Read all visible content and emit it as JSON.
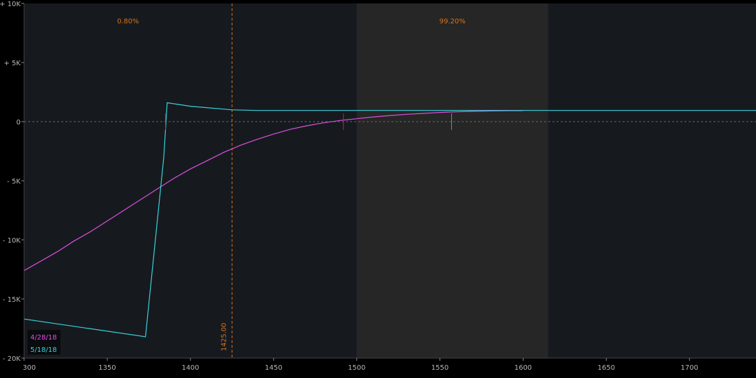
{
  "chart_data": {
    "type": "line",
    "title": "",
    "xlabel": "",
    "ylabel": "",
    "xlim": [
      1300,
      1740
    ],
    "ylim": [
      -20000,
      10000
    ],
    "x_ticks": [
      {
        "value": 1300,
        "label": "300"
      },
      {
        "value": 1350,
        "label": "1350"
      },
      {
        "value": 1400,
        "label": "1400"
      },
      {
        "value": 1450,
        "label": "1450"
      },
      {
        "value": 1500,
        "label": "1500"
      },
      {
        "value": 1550,
        "label": "1550"
      },
      {
        "value": 1600,
        "label": "1600"
      },
      {
        "value": 1650,
        "label": "1650"
      },
      {
        "value": 1700,
        "label": "1700"
      }
    ],
    "y_ticks": [
      {
        "value": 10000,
        "label": "+ 10K"
      },
      {
        "value": 5000,
        "label": "+ 5K"
      },
      {
        "value": 0,
        "label": "0"
      },
      {
        "value": -5000,
        "label": "- 5K"
      },
      {
        "value": -10000,
        "label": "- 10K"
      },
      {
        "value": -15000,
        "label": "- 15K"
      },
      {
        "value": -20000,
        "label": "- 20K"
      }
    ],
    "grid": false,
    "legend_position": "bottom-left",
    "regions": [
      {
        "x_start": 1300,
        "x_end": 1425,
        "label": "0.80%",
        "color": "#161a1f"
      },
      {
        "x_start": 1500,
        "x_end": 1615,
        "label": "99.20%",
        "color": "#262626"
      }
    ],
    "vertical_marker": {
      "x": 1425,
      "label": "1425.00",
      "color": "#d8731a"
    },
    "zero_line_color": "#666666",
    "series": [
      {
        "name": "4/28/18",
        "color": "#e04fe0",
        "x": [
          1300,
          1310,
          1320,
          1330,
          1340,
          1350,
          1360,
          1370,
          1380,
          1390,
          1400,
          1410,
          1420,
          1430,
          1440,
          1450,
          1460,
          1470,
          1480,
          1490,
          1500,
          1510,
          1520,
          1530,
          1540,
          1550,
          1560,
          1570,
          1580,
          1590,
          1600
        ],
        "y": [
          -12600,
          -11800,
          -11000,
          -10100,
          -9300,
          -8400,
          -7500,
          -6600,
          -5700,
          -4800,
          -4000,
          -3300,
          -2600,
          -2000,
          -1500,
          -1050,
          -650,
          -350,
          -100,
          100,
          250,
          400,
          520,
          620,
          700,
          780,
          830,
          870,
          900,
          920,
          930
        ]
      },
      {
        "name": "5/18/18",
        "color": "#39d5dd",
        "x": [
          1300,
          1373,
          1384,
          1386,
          1400,
          1425,
          1440,
          1500,
          1600,
          1740
        ],
        "y": [
          -16700,
          -18200,
          -3000,
          1600,
          1300,
          1000,
          950,
          950,
          950,
          950
        ]
      }
    ],
    "markers": [
      {
        "x": 1492,
        "y": 0,
        "color": "#d51d1d"
      },
      {
        "x": 1385,
        "y": 0,
        "color": "#d51d1d"
      },
      {
        "x": 1557,
        "y": 0,
        "color": "#c0802a"
      }
    ]
  }
}
